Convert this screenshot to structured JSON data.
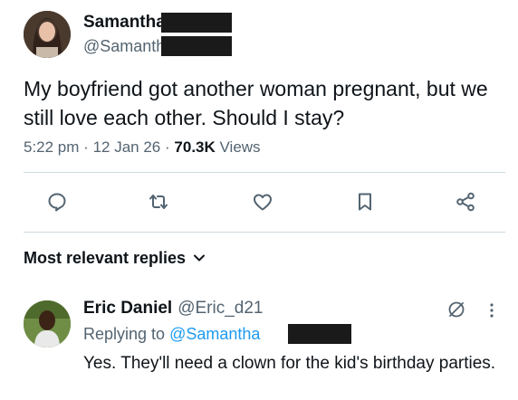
{
  "author": {
    "name": "Samantha",
    "handle": "@Samanth"
  },
  "tweet": {
    "text": "My boyfriend got another woman pregnant, but we still love each other. Should I stay?",
    "time": "5:22 pm",
    "sep1": "·",
    "date": "12 Jan 26",
    "sep2": "·",
    "views_count": "70.3K",
    "views_label": "Views"
  },
  "actions": [
    {
      "icon": "reply-icon"
    },
    {
      "icon": "retweet-icon"
    },
    {
      "icon": "like-icon"
    },
    {
      "icon": "bookmark-icon"
    },
    {
      "icon": "share-icon"
    }
  ],
  "replies_header": {
    "label": "Most relevant replies"
  },
  "reply": {
    "name": "Eric Daniel",
    "handle": "@Eric_d21",
    "replying_prefix": "Replying to",
    "replying_to": "@Samantha",
    "text": "Yes. They'll need a clown for the kid's birthday parties."
  },
  "colors": {
    "text": "#0f1419",
    "secondary": "#536471",
    "link": "#1d9bf0",
    "divider": "#cfd9de",
    "redaction": "#1a1a1a"
  }
}
